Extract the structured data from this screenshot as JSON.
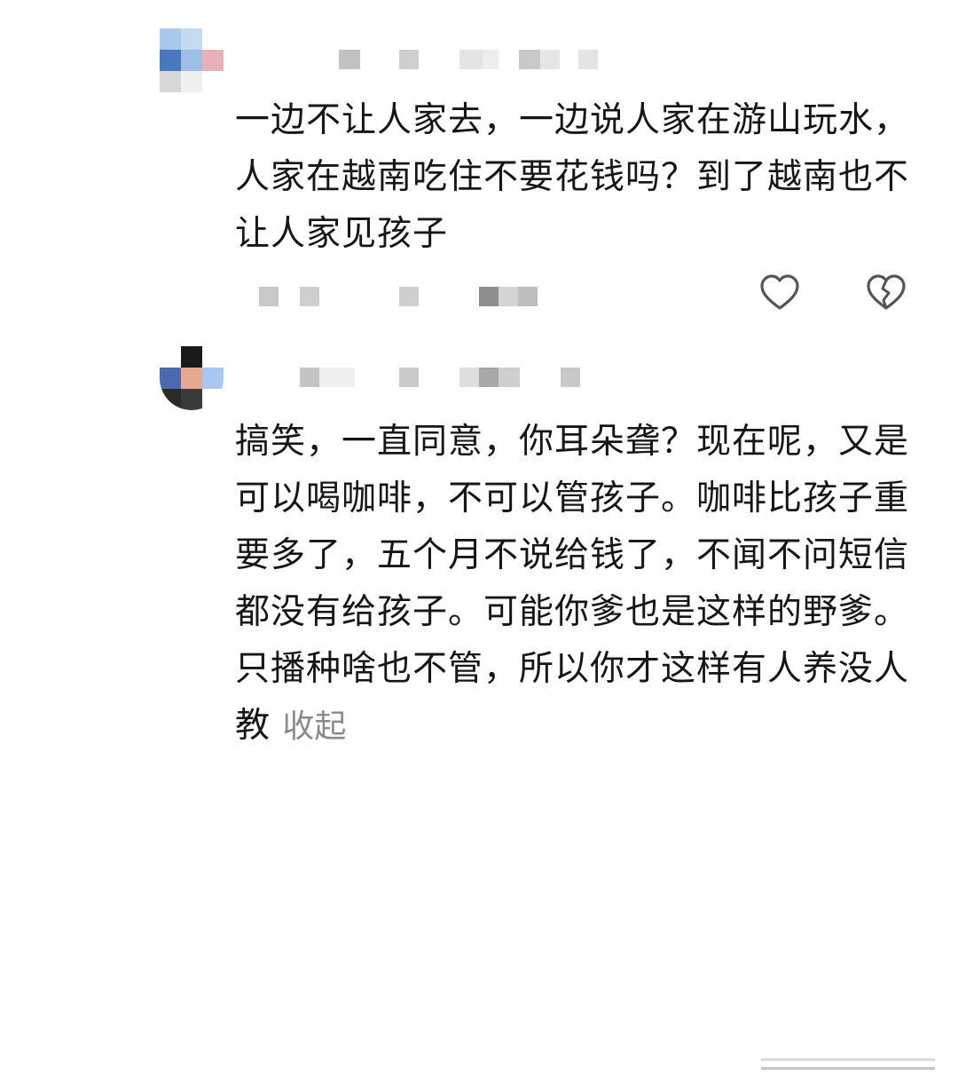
{
  "comments": [
    {
      "text": "一边不让人家去，一边说人家在游山玩水，人家在越南吃住不要花钱吗？到了越南也不让人家见孩子",
      "avatar_colors": [
        "#a8c8ec",
        "#c4dcf2",
        "#ffffff",
        "#4a78c0",
        "#9ec0e8",
        "#e8b0b8",
        "#d8d8d8",
        "#f0f0f0",
        "#ffffff"
      ]
    },
    {
      "text": "搞笑，一直同意，你耳朵聋？现在呢，又是可以喝咖啡，不可以管孩子。咖啡比孩子重要多了，五个月不说给钱了，不闻不问短信都没有给孩子。可能你爹也是这样的野爹。只播种啥也不管，所以你才这样有人养没人教",
      "collapse_label": "收起",
      "avatar_colors": [
        "#ffffff",
        "#1a1a1a",
        "#ffffff",
        "#4a6ab0",
        "#e8a890",
        "#a8c8f0",
        "#2a2a2a",
        "#3a3a3a",
        "#ffffff"
      ]
    }
  ],
  "icons": {
    "like": "heart-outline-icon",
    "dislike": "broken-heart-icon"
  },
  "colors": {
    "text": "#161616",
    "collapse": "#8a8a8a",
    "icon_stroke": "#555555",
    "blur_block": "#bdbdbd"
  }
}
